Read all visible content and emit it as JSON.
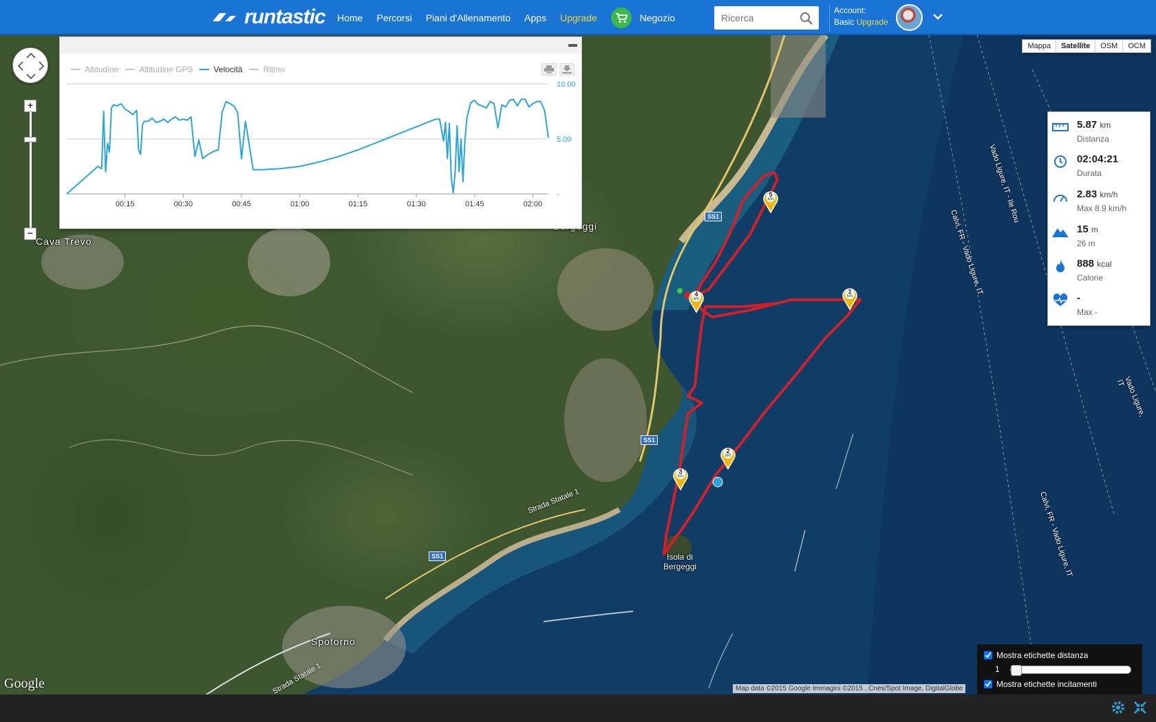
{
  "nav": {
    "logo": "runtastic",
    "items": [
      "Home",
      "Percorsi",
      "Piani d'Allenamento",
      "Apps"
    ],
    "upgrade": "Upgrade",
    "shop": "Negozio",
    "search_placeholder": "Ricerca",
    "account_label": "Account:",
    "account_type": "Basic",
    "account_upgrade": "Upgrade"
  },
  "map_types": [
    "Mappa",
    "Satellite",
    "OSM",
    "OCM"
  ],
  "map_type_selected": "Satellite",
  "places": {
    "cava": "Cava Trevo",
    "bergeggi": "Bergeggi",
    "isola_1": "Isola di",
    "isola_2": "Bergeggi",
    "spotorno": "Spotorno",
    "strada1": "Strada Statale 1",
    "strada2": "Strada Statale 1",
    "shield": "SS1",
    "route1": "Vado Ligure, IT - Ile Rou",
    "route2": "Calvi, FR - Vado Ligure, IT",
    "route3": "Calvi, FR - Vado Ligure, IT",
    "route4": "Vado Ligure, IT",
    "google": "Google",
    "attribution": "Map data ©2015 Google Immagini ©2015 , Cnes/Spot Image, DigitalGlobe"
  },
  "km_markers": [
    "1",
    "2",
    "3",
    "4",
    "5"
  ],
  "km_unit": "km",
  "chart": {
    "legend": [
      "Altitudine",
      "Altitudine GPS",
      "Velocità",
      "Ritmo"
    ],
    "active": "Velocità"
  },
  "chart_data": {
    "type": "line",
    "title": "",
    "series": [
      {
        "name": "Velocità"
      }
    ],
    "x_ticks": [
      "00:15",
      "00:30",
      "00:45",
      "01:00",
      "01:15",
      "01:30",
      "01:45",
      "02:00"
    ],
    "y_ticks": [
      "10.00",
      "5.00",
      "-"
    ],
    "ylim": [
      0,
      10
    ],
    "x_minutes": [
      0,
      8,
      9,
      9.5,
      10,
      10.5,
      11,
      11.5,
      12,
      13,
      14,
      15,
      16,
      17,
      18,
      18.5,
      19,
      19.5,
      20,
      21,
      22,
      23,
      24,
      25,
      26,
      27,
      28,
      29,
      30,
      31,
      32,
      33,
      34,
      35,
      36,
      37,
      38,
      39,
      40,
      41,
      42,
      43,
      44,
      45,
      46,
      48,
      50,
      55,
      60,
      65,
      70,
      75,
      80,
      85,
      90,
      95,
      96,
      97,
      97.5,
      98,
      98.5,
      99,
      99.5,
      100,
      100.5,
      101,
      101.5,
      102,
      102.5,
      103,
      104,
      105,
      106,
      107,
      108,
      109,
      110,
      111,
      112,
      113,
      114,
      115,
      116,
      117,
      118,
      119,
      120,
      121,
      122,
      123,
      124
    ],
    "values": [
      0,
      2.5,
      2.3,
      7.5,
      2.0,
      4.6,
      3.8,
      7.8,
      8.1,
      8.0,
      8.2,
      7.7,
      7.5,
      7.2,
      7.6,
      4.0,
      3.6,
      6.3,
      6.6,
      6.6,
      6.9,
      6.5,
      6.6,
      6.8,
      6.5,
      6.8,
      7.0,
      6.7,
      6.8,
      6.7,
      7.0,
      3.4,
      4.9,
      3.2,
      3.5,
      3.7,
      3.9,
      4.0,
      7.4,
      8.4,
      8.2,
      8.0,
      7.4,
      3.2,
      6.6,
      2.2,
      2.2,
      2.3,
      2.5,
      2.9,
      3.4,
      4.0,
      4.7,
      5.4,
      6.1,
      6.8,
      6.8,
      4.8,
      6.5,
      3.2,
      6.4,
      1.4,
      0.1,
      2.0,
      6.2,
      2.0,
      5.0,
      1.1,
      4.8,
      6.9,
      8.3,
      8.5,
      8.1,
      8.0,
      7.8,
      8.4,
      8.2,
      6.0,
      8.1,
      7.9,
      8.5,
      8.6,
      8.0,
      8.6,
      8.6,
      7.9,
      8.2,
      8.4,
      8.4,
      7.6,
      5.1
    ]
  },
  "stats": [
    {
      "icon": "ruler-icon",
      "value": "5.87",
      "unit": "km",
      "label": "Distanza"
    },
    {
      "icon": "clock-icon",
      "value": "02:04:21",
      "unit": "",
      "label": "Durata"
    },
    {
      "icon": "speedometer-icon",
      "value": "2.83",
      "unit": "km/h",
      "label": "Max 8.9 km/h"
    },
    {
      "icon": "mountain-icon",
      "value": "15",
      "unit": "m",
      "label": "26 m"
    },
    {
      "icon": "flame-icon",
      "value": "888",
      "unit": "kcal",
      "label": "Calorie"
    },
    {
      "icon": "heart-rate-icon",
      "value": "-",
      "unit": "",
      "label": "Max -"
    }
  ],
  "options": {
    "distance_labels": "Mostra etichette distanza",
    "slider_value": "1",
    "cheer_labels": "Mostra etichette incitamenti"
  },
  "colors": {
    "brand": "#1a74d6",
    "route": "#d21f2a",
    "speed_line": "#2aa4dc",
    "upgrade": "#f5d43a"
  }
}
